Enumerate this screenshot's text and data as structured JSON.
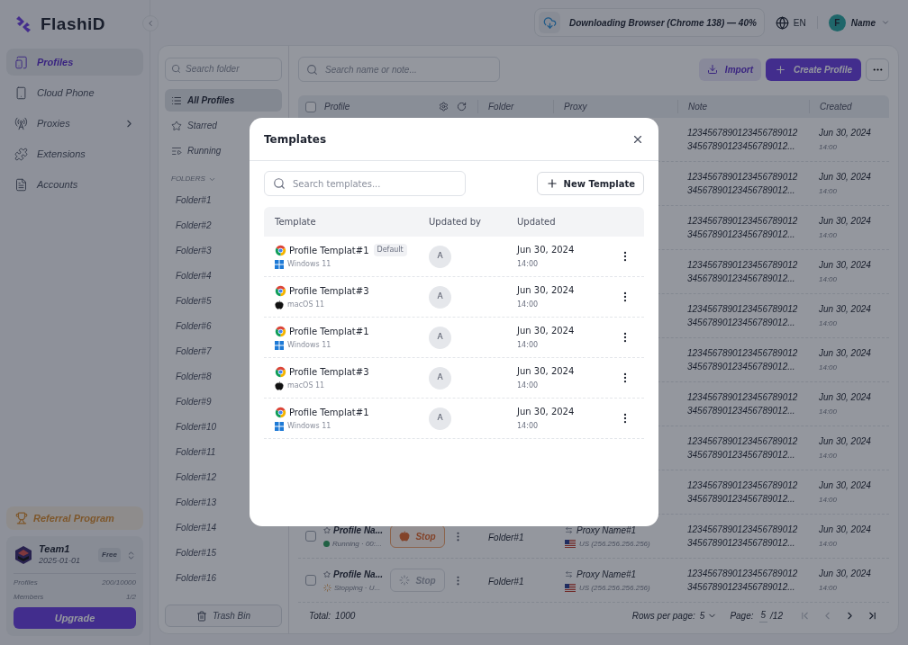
{
  "logo": {
    "text": "FlashiD"
  },
  "sidebar": {
    "items": [
      {
        "label": "Profiles",
        "selected": true,
        "has_submenu": false
      },
      {
        "label": "Cloud Phone",
        "selected": false,
        "has_submenu": false
      },
      {
        "label": "Proxies",
        "selected": false,
        "has_submenu": true
      },
      {
        "label": "Extensions",
        "selected": false,
        "has_submenu": false
      },
      {
        "label": "Accounts",
        "selected": false,
        "has_submenu": false
      }
    ],
    "referral": "Referral Program",
    "team": {
      "name": "Team1",
      "date": "2025-01-01",
      "plan": "Free",
      "stats": [
        {
          "label": "Profiles",
          "value": "200/10000"
        },
        {
          "label": "Members",
          "value": "1/2"
        }
      ]
    },
    "upgrade": "Upgrade"
  },
  "topbar": {
    "download": "Downloading Browser (Chrome 138) — 40%",
    "language": "EN",
    "user": {
      "initial": "F",
      "name": "Name"
    }
  },
  "folders": {
    "search_placeholder": "Search folder",
    "views": [
      {
        "label": "All Profiles",
        "selected": true
      },
      {
        "label": "Starred",
        "selected": false
      },
      {
        "label": "Running",
        "selected": false
      }
    ],
    "section": "FOLDERS",
    "items": [
      "Folder#1",
      "Folder#2",
      "Folder#3",
      "Folder#4",
      "Folder#5",
      "Folder#6",
      "Folder#7",
      "Folder#8",
      "Folder#9",
      "Folder#10",
      "Folder#11",
      "Folder#12",
      "Folder#13",
      "Folder#14",
      "Folder#15",
      "Folder#16"
    ],
    "trash": "Trash Bin"
  },
  "profiles": {
    "search_placeholder": "Search name or note...",
    "import": "Import",
    "create": "Create Profile",
    "select_all_checked": false,
    "columns": [
      "Profile",
      "Folder",
      "Proxy",
      "Note",
      "Created"
    ],
    "rows": [
      {
        "note": [
          "1234567890123456789012",
          "34567890123456789012..."
        ],
        "date": "Jun 30, 2024",
        "time": "14:00"
      },
      {
        "note": [
          "1234567890123456789012",
          "34567890123456789012..."
        ],
        "date": "Jun 30, 2024",
        "time": "14:00"
      },
      {
        "note": [
          "1234567890123456789012",
          "34567890123456789012..."
        ],
        "date": "Jun 30, 2024",
        "time": "14:00"
      },
      {
        "note": [
          "1234567890123456789012",
          "34567890123456789012..."
        ],
        "date": "Jun 30, 2024",
        "time": "14:00"
      },
      {
        "note": [
          "1234567890123456789012",
          "34567890123456789012..."
        ],
        "date": "Jun 30, 2024",
        "time": "14:00"
      },
      {
        "note": [
          "1234567890123456789012",
          "34567890123456789012..."
        ],
        "date": "Jun 30, 2024",
        "time": "14:00"
      },
      {
        "note": [
          "1234567890123456789012",
          "34567890123456789012..."
        ],
        "date": "Jun 30, 2024",
        "time": "14:00"
      },
      {
        "note": [
          "1234567890123456789012",
          "34567890123456789012..."
        ],
        "date": "Jun 30, 2024",
        "time": "14:00"
      },
      {
        "note": [
          "1234567890123456789012",
          "34567890123456789012..."
        ],
        "date": "Jun 30, 2024",
        "time": "14:00"
      },
      {
        "checked": false,
        "starred": false,
        "name": "Profile Na...",
        "kind": "running",
        "status_text": "Running · 00:...",
        "action": "Stop",
        "action_disabled": false,
        "folder": "Folder#1",
        "proxy_name": "Proxy Name#1",
        "proxy_address": "US (256.256.256.256)",
        "note": [
          "1234567890123456789012",
          "34567890123456789012..."
        ],
        "date": "Jun 30, 2024",
        "time": "14:00"
      },
      {
        "checked": false,
        "starred": false,
        "name": "Profile Na...",
        "kind": "stopping",
        "status_text": "Stopping · U...",
        "action": "Stop",
        "action_disabled": true,
        "folder": "Folder#1",
        "proxy_name": "Proxy Name#1",
        "proxy_address": "US (256.256.256.256)",
        "note": [
          "1234567890123456789012",
          "34567890123456789012..."
        ],
        "date": "Jun 30, 2024",
        "time": "14:00"
      }
    ],
    "footer": {
      "total_label": "Total:",
      "total": "1000",
      "rows_per_page_label": "Rows per page:",
      "rows_per_page": "5",
      "page_label": "Page:",
      "page": "5",
      "pages": "/12",
      "first_disabled": true,
      "prev_disabled": true,
      "next_disabled": false,
      "last_disabled": false
    }
  },
  "modal": {
    "title": "Templates",
    "search_placeholder": "Search templates...",
    "new_button": "New Template",
    "columns": [
      "Template",
      "Updated by",
      "Updated"
    ],
    "rows": [
      {
        "name": "Profile Templat#1",
        "badge": "Default",
        "kind": "windows",
        "os_label": "Windows 11",
        "updated_by": "A",
        "date": "Jun 30, 2024",
        "time": "14:00"
      },
      {
        "name": "Profile Templat#3",
        "kind": "mac",
        "os_label": "macOS 11",
        "updated_by": "A",
        "date": "Jun 30, 2024",
        "time": "14:00"
      },
      {
        "name": "Profile Templat#1",
        "kind": "windows",
        "os_label": "Windows 11",
        "updated_by": "A",
        "date": "Jun 30, 2024",
        "time": "14:00"
      },
      {
        "name": "Profile Templat#3",
        "kind": "mac",
        "os_label": "macOS 11",
        "updated_by": "A",
        "date": "Jun 30, 2024",
        "time": "14:00"
      },
      {
        "name": "Profile Templat#1",
        "kind": "windows",
        "os_label": "Windows 11",
        "updated_by": "A",
        "date": "Jun 30, 2024",
        "time": "14:00"
      }
    ]
  }
}
